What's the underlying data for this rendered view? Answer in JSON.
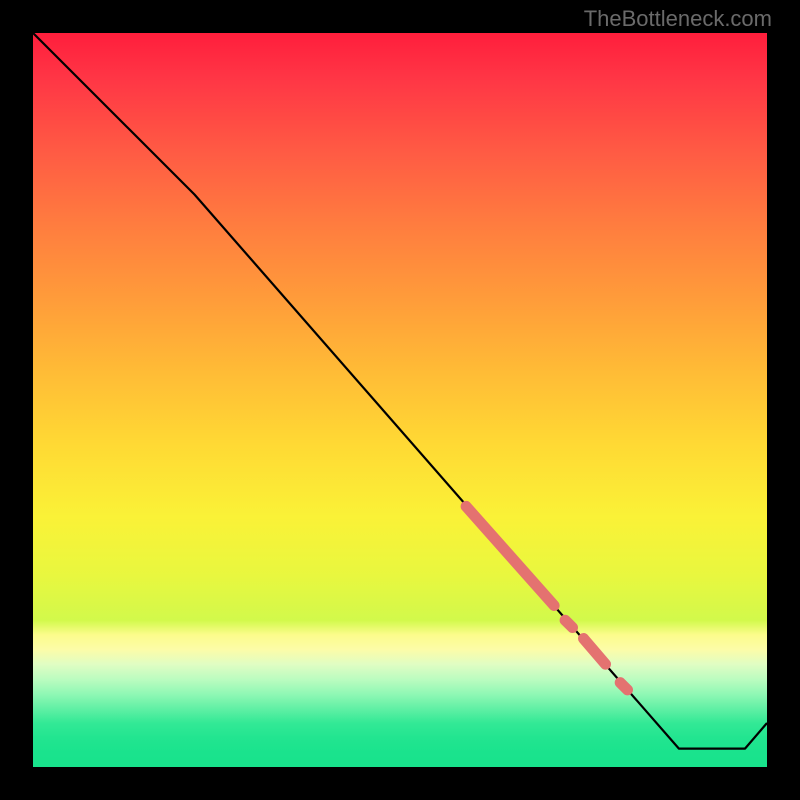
{
  "watermark": "TheBottleneck.com",
  "chart_data": {
    "type": "line",
    "title": "",
    "xlabel": "",
    "ylabel": "",
    "xlim": [
      0,
      100
    ],
    "ylim": [
      0,
      100
    ],
    "line_points": [
      {
        "x": 0,
        "y": 100
      },
      {
        "x": 22,
        "y": 78
      },
      {
        "x": 88,
        "y": 2.5
      },
      {
        "x": 97,
        "y": 2.5
      },
      {
        "x": 100,
        "y": 6
      }
    ],
    "highlight_segments": [
      {
        "x1": 59,
        "y1": 35.5,
        "x2": 71,
        "y2": 22,
        "thickness": "thick"
      },
      {
        "x1": 72.5,
        "y1": 20,
        "x2": 73.5,
        "y2": 19,
        "thickness": "thick"
      },
      {
        "x1": 75,
        "y1": 17.5,
        "x2": 78,
        "y2": 14,
        "thickness": "thick"
      },
      {
        "x1": 80,
        "y1": 11.5,
        "x2": 81,
        "y2": 10.5,
        "thickness": "thick"
      }
    ],
    "highlight_color": "#e47270",
    "gradient_stops": [
      {
        "pos": 0,
        "color": "#ff1e3c"
      },
      {
        "pos": 50,
        "color": "#ffd934"
      },
      {
        "pos": 72,
        "color": "#faf237"
      },
      {
        "pos": 100,
        "color": "#18e38c"
      }
    ]
  }
}
